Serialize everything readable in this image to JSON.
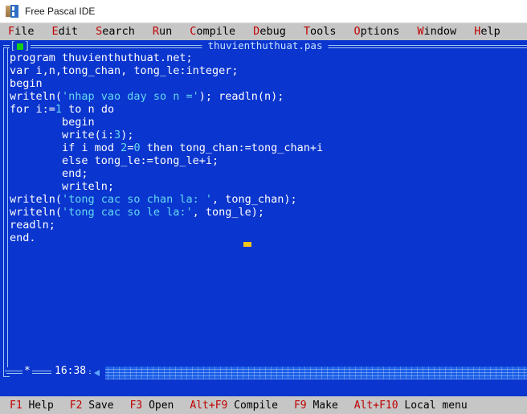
{
  "window": {
    "os_title": "Free Pascal IDE",
    "os_icon": "fpc-logo-icon"
  },
  "menubar": {
    "items": [
      {
        "hotkey": "F",
        "rest": "ile"
      },
      {
        "hotkey": "E",
        "rest": "dit"
      },
      {
        "hotkey": "S",
        "rest": "earch"
      },
      {
        "hotkey": "R",
        "rest": "un"
      },
      {
        "hotkey": "C",
        "rest": "ompile"
      },
      {
        "hotkey": "D",
        "rest": "ebug"
      },
      {
        "hotkey": "T",
        "rest": "ools"
      },
      {
        "hotkey": "O",
        "rest": "ptions"
      },
      {
        "hotkey": "W",
        "rest": "indow"
      },
      {
        "hotkey": "H",
        "rest": "elp"
      }
    ]
  },
  "editor": {
    "title": "thuvienthuthuat.pas",
    "close_box_label": "close-box",
    "modified_indicator": "*",
    "cursor_position": "16:38",
    "lines": [
      [
        {
          "t": "program thuvienthuthuat.net;",
          "c": "plain"
        }
      ],
      [
        {
          "t": "var i,n,tong_chan, tong_le:integer;",
          "c": "plain"
        }
      ],
      [
        {
          "t": "begin",
          "c": "plain"
        }
      ],
      [
        {
          "t": "writeln(",
          "c": "plain"
        },
        {
          "t": "'nhap vao day so n ='",
          "c": "str"
        },
        {
          "t": "); readln(n);",
          "c": "plain"
        }
      ],
      [
        {
          "t": "for i:=",
          "c": "plain"
        },
        {
          "t": "1",
          "c": "num"
        },
        {
          "t": " to n do",
          "c": "plain"
        }
      ],
      [
        {
          "t": "        begin",
          "c": "plain"
        }
      ],
      [
        {
          "t": "        write(i:",
          "c": "plain"
        },
        {
          "t": "3",
          "c": "num"
        },
        {
          "t": ");",
          "c": "plain"
        }
      ],
      [
        {
          "t": "        if i mod ",
          "c": "plain"
        },
        {
          "t": "2",
          "c": "num"
        },
        {
          "t": "=",
          "c": "plain"
        },
        {
          "t": "0",
          "c": "num"
        },
        {
          "t": " then tong_chan:=tong_chan+i",
          "c": "plain"
        }
      ],
      [
        {
          "t": "        else tong_le:=tong_le+i;",
          "c": "plain"
        }
      ],
      [
        {
          "t": "        end;",
          "c": "plain"
        }
      ],
      [
        {
          "t": "        writeln;",
          "c": "plain"
        }
      ],
      [
        {
          "t": "writeln(",
          "c": "plain"
        },
        {
          "t": "'tong cac so chan la: '",
          "c": "str"
        },
        {
          "t": ", tong_chan);",
          "c": "plain"
        }
      ],
      [
        {
          "t": "writeln(",
          "c": "plain"
        },
        {
          "t": "'tong cac so le la:'",
          "c": "str"
        },
        {
          "t": ", tong_le);",
          "c": "plain"
        }
      ],
      [
        {
          "t": "readln;",
          "c": "plain"
        }
      ],
      [
        {
          "t": "end.",
          "c": "plain"
        }
      ]
    ]
  },
  "statusbar": {
    "items": [
      {
        "key": "F1",
        "label": "Help"
      },
      {
        "key": "F2",
        "label": "Save"
      },
      {
        "key": "F3",
        "label": "Open"
      },
      {
        "key": "Alt+F9",
        "label": "Compile"
      },
      {
        "key": "F9",
        "label": "Make"
      },
      {
        "key": "Alt+F10",
        "label": "Local menu"
      }
    ]
  },
  "colors": {
    "desktop_blue": "#0a35ce",
    "frame_light": "#9ec8f0",
    "code_text": "#ffffff",
    "string_cyan": "#62d9f0",
    "close_green": "#13d013",
    "cursor_yellow": "#f5c518",
    "menu_gray": "#c6c6c6",
    "hotkey_red": "#c00000"
  }
}
